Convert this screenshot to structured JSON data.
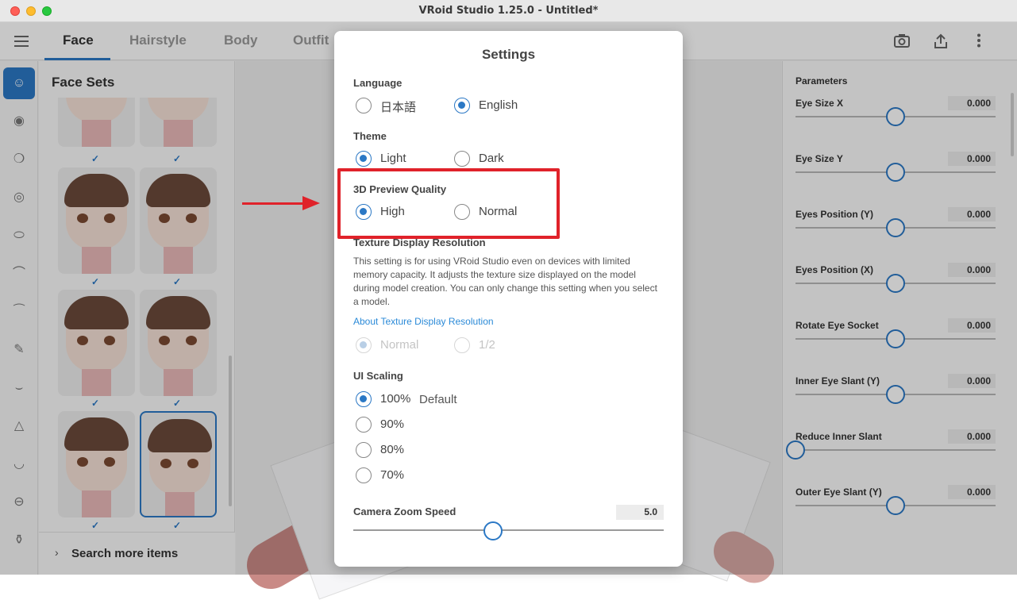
{
  "window": {
    "title": "VRoid Studio 1.25.0 - Untitled*"
  },
  "nav": {
    "tabs": [
      {
        "label": "Face"
      },
      {
        "label": "Hairstyle"
      },
      {
        "label": "Body"
      },
      {
        "label": "Outfit"
      }
    ],
    "active_tab": "Face",
    "right_icons": [
      "camera-icon",
      "export-icon",
      "more-icon"
    ]
  },
  "sidebar": {
    "icons": [
      "face-icon",
      "eye-icon",
      "ear-icon",
      "eye-outline-icon",
      "oval-icon",
      "eyebrow-icon",
      "eyelash-icon",
      "brush-icon",
      "closed-eye-icon",
      "nose-icon",
      "mouth-icon",
      "lips-icon",
      "bottle-icon"
    ]
  },
  "face_panel": {
    "title": "Face Sets",
    "search_more": "Search more items"
  },
  "parameters": {
    "title": "Parameters",
    "items": [
      {
        "name": "Eye Size X",
        "value": "0.000",
        "level": 0.5
      },
      {
        "name": "Eye Size Y",
        "value": "0.000",
        "level": 0.5
      },
      {
        "name": "Eyes Position (Y)",
        "value": "0.000",
        "level": 0.5
      },
      {
        "name": "Eyes Position (X)",
        "value": "0.000",
        "level": 0.5
      },
      {
        "name": "Rotate Eye Socket",
        "value": "0.000",
        "level": 0.5
      },
      {
        "name": "Inner Eye Slant (Y)",
        "value": "0.000",
        "level": 0.5
      },
      {
        "name": "Reduce Inner Slant",
        "value": "0.000",
        "level": 0.0
      },
      {
        "name": "Outer Eye Slant (Y)",
        "value": "0.000",
        "level": 0.5
      }
    ]
  },
  "settings": {
    "title": "Settings",
    "language": {
      "label": "Language",
      "options": [
        "日本語",
        "English"
      ],
      "selected": "English"
    },
    "theme": {
      "label": "Theme",
      "options": [
        "Light",
        "Dark"
      ],
      "selected": "Light"
    },
    "preview_quality": {
      "label": "3D Preview Quality",
      "options": [
        "High",
        "Normal"
      ],
      "selected": "High"
    },
    "texture": {
      "label": "Texture Display Resolution",
      "description": "This setting is for using VRoid Studio even on devices with limited memory capacity. It adjusts the texture size displayed on the model during model creation. You can only change this setting when you select a model.",
      "link": "About Texture Display Resolution",
      "options": [
        "Normal",
        "1/2"
      ],
      "selected": "Normal",
      "disabled": true
    },
    "ui_scaling": {
      "label": "UI Scaling",
      "options": [
        "100%",
        "90%",
        "80%",
        "70%"
      ],
      "selected": "100%",
      "default_tag": "Default"
    },
    "camera_zoom": {
      "label": "Camera Zoom Speed",
      "value": "5.0",
      "level": 0.45
    }
  },
  "colors": {
    "accent": "#2b78c5",
    "annotation": "#e0222a"
  }
}
